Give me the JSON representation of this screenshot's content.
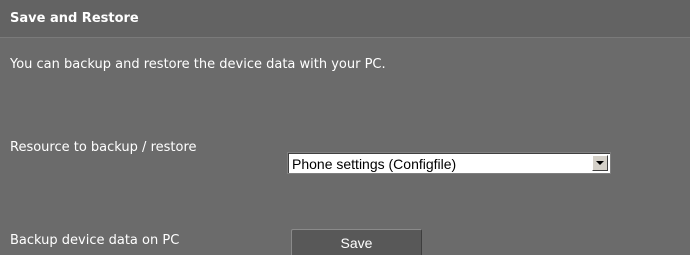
{
  "section": {
    "title": "Save and Restore",
    "description": "You can backup and restore the device data with your PC."
  },
  "resource": {
    "label": "Resource to backup / restore",
    "selected": "Phone settings (Configfile)",
    "dropdown_icon": "chevron-down-icon"
  },
  "backup": {
    "label": "Backup device data on PC",
    "button_label": "Save"
  },
  "colors": {
    "panel_background": "#6b6b6b",
    "header_background": "#636363",
    "text": "#ffffff",
    "button_background": "#585858"
  }
}
